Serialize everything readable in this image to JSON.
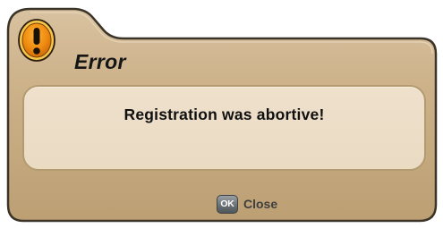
{
  "dialog": {
    "title": "Error",
    "title_icon": "exclamation-warning-icon",
    "message": "Registration was abortive!",
    "actions": [
      {
        "key": "OK",
        "label": "Close"
      }
    ]
  },
  "colors": {
    "frame_tan": "#c7ac82",
    "frame_border": "#3b3428",
    "panel_fill": "#ecdec7",
    "icon_orange": "#e88a12",
    "icon_ring": "#f7c24b",
    "ok_key_gray": "#6f767a"
  }
}
